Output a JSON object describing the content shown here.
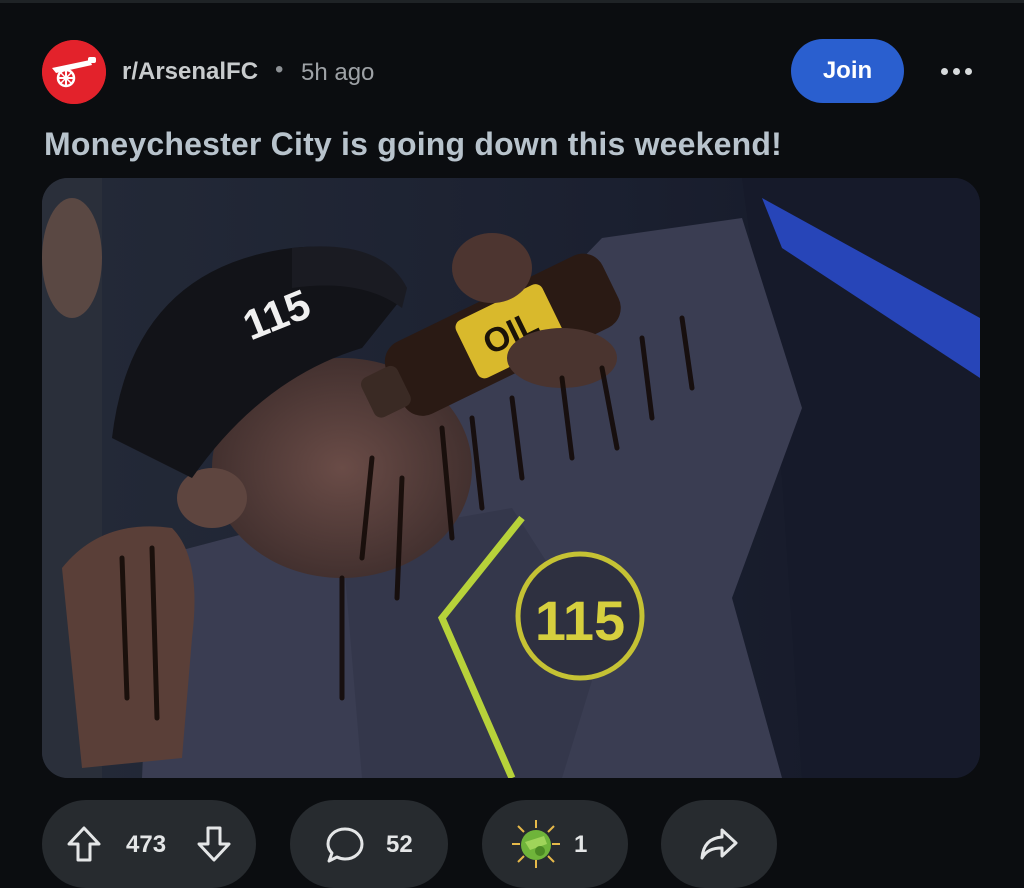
{
  "post": {
    "subreddit": "r/ArsenalFC",
    "separator": "•",
    "time_ago": "5h ago",
    "join_label": "Join",
    "title": "Moneychester City is going down this weekend!"
  },
  "image": {
    "cap_number": "115",
    "bottle_label": "OIL",
    "badge_number": "115"
  },
  "actions": {
    "upvotes": "473",
    "comments": "52",
    "awards": "1"
  },
  "colors": {
    "background": "#0b0d10",
    "join_button": "#2a5fcf",
    "pill": "#272b2f",
    "subreddit_icon": "#e3222b"
  },
  "icons": [
    "subreddit-avatar-icon",
    "more-options-icon",
    "upvote-icon",
    "downvote-icon",
    "comment-icon",
    "award-icon",
    "share-icon"
  ]
}
